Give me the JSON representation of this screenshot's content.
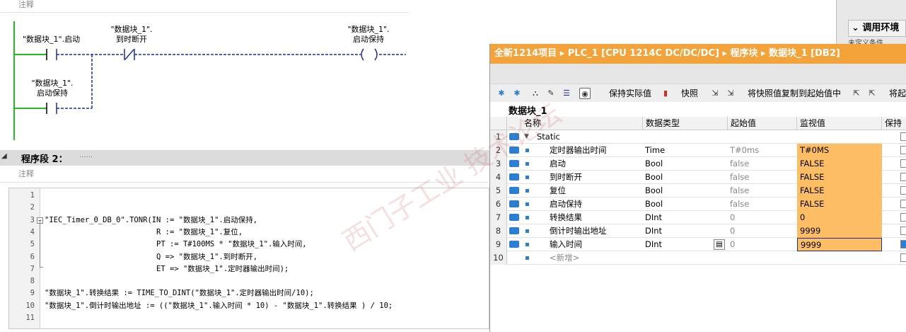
{
  "ladder": {
    "comment_label": "注释",
    "contact1_line1": "\"数据块_1\".启动",
    "contact2_line1": "\"数据块_1\".",
    "contact2_line2": "到时断开",
    "coil_line1": "\"数据块_1\".",
    "coil_line2": "启动保持",
    "contact3_line1": "\"数据块_1\".",
    "contact3_line2": "启动保持"
  },
  "segment2": {
    "title": "程序段 2：",
    "dots": "......",
    "comment_label": "注释"
  },
  "code": [
    {
      "n": "1",
      "t": ""
    },
    {
      "n": "2",
      "t": ""
    },
    {
      "n": "3",
      "t": "\"IEC_Timer_0_DB_0\".TONR(IN := \"数据块_1\".启动保持,"
    },
    {
      "n": "4",
      "t": "                         R := \"数据块_1\".复位,"
    },
    {
      "n": "5",
      "t": "                         PT := T#100MS * \"数据块_1\".输入时间,"
    },
    {
      "n": "6",
      "t": "                         Q => \"数据块_1\".到时断开,"
    },
    {
      "n": "7",
      "t": "                         ET => \"数据块_1\".定时器输出时间);"
    },
    {
      "n": "8",
      "t": ""
    },
    {
      "n": "9",
      "t": "\"数据块_1\".转换结果 := TIME_TO_DINT(\"数据块_1\".定时器输出时间/10);"
    },
    {
      "n": "10",
      "t": "\"数据块_1\".倒计时输出地址 := ((\"数据块_1\".输入时间 * 10) - \"数据块_1\".转换结果 ) / 10;"
    },
    {
      "n": "11",
      "t": ""
    }
  ],
  "right_panel": {
    "header": "调用环境",
    "sub": "未定义条件"
  },
  "db": {
    "breadcrumb": "全新1214项目  ▸  PLC_1 [CPU 1214C DC/DC/DC]  ▸  程序块  ▸  数据块_1 [DB2]",
    "toolbar": {
      "keep_actual": "保持实际值",
      "snapshot": "快照",
      "copy_snapshot": "将快照值复制到起始值中",
      "more": "将起"
    },
    "name": "数据块_1",
    "headers": {
      "name": "名称",
      "type": "数据类型",
      "start": "起始值",
      "monitor": "监视值",
      "retain": "保持"
    },
    "rows": [
      {
        "n": "1",
        "name": "Static",
        "type": "",
        "start": "",
        "monitor": "",
        "static": true
      },
      {
        "n": "2",
        "name": "定时器输出时间",
        "type": "Time",
        "start": "T#0ms",
        "monitor": "T#0MS"
      },
      {
        "n": "3",
        "name": "启动",
        "type": "Bool",
        "start": "false",
        "monitor": "FALSE"
      },
      {
        "n": "4",
        "name": "到时断开",
        "type": "Bool",
        "start": "false",
        "monitor": "FALSE"
      },
      {
        "n": "5",
        "name": "复位",
        "type": "Bool",
        "start": "false",
        "monitor": "FALSE"
      },
      {
        "n": "6",
        "name": "启动保持",
        "type": "Bool",
        "start": "false",
        "monitor": "FALSE"
      },
      {
        "n": "7",
        "name": "转换结果",
        "type": "DInt",
        "start": "0",
        "monitor": "0"
      },
      {
        "n": "8",
        "name": "倒计时输出地址",
        "type": "DInt",
        "start": "0",
        "monitor": "9999"
      },
      {
        "n": "9",
        "name": "输入时间",
        "type": "DInt",
        "start": "0",
        "monitor": "9999"
      },
      {
        "n": "10",
        "name": "<新增>",
        "type": "",
        "start": "",
        "monitor": "",
        "add": true
      }
    ]
  },
  "watermark": "西门子工业 技术论坛"
}
